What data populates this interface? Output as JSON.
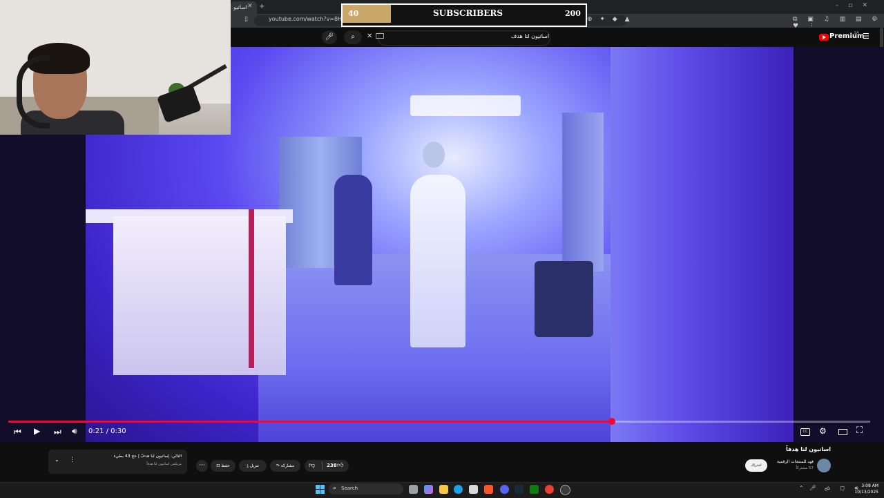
{
  "browser": {
    "tab_title": "اساتيو",
    "url": "youtube.com/watch?v=8HjQWAd…dYDrk&start_radio=1"
  },
  "youtube": {
    "search_query": "اساتيون لنا هدف",
    "logo_text": "Premium",
    "logo_region": "SA"
  },
  "overlay": {
    "subscriber_current": "40",
    "subscriber_label": "SUBSCRIBERS",
    "subscriber_target": "200",
    "subscriber_progress": 0.2
  },
  "player": {
    "time_display": "0:21 / 0:30",
    "progress_fraction": 0.7
  },
  "video": {
    "title": "اساتيون لنا هدفاً",
    "channel_name": "فهد للمنتجات الرقمية",
    "channel_subs": "57 مشتركاً",
    "subscribe_label": "اشتراك",
    "like_count": "238",
    "share_label": "مشاركة",
    "download_label": "تنزيل",
    "save_label": "حفظ",
    "more_label": "···"
  },
  "mini_card": {
    "title": "التالي: إساتيون لنا هدفٌ | حج 43 بطيء",
    "subtitle": "مزيكس اساتيون لنا هدفاً"
  },
  "taskbar": {
    "search_placeholder": "Search",
    "lang": "ع",
    "clock_time": "3:08 AM",
    "clock_date": "10/13/2025"
  },
  "colors": {
    "progress": "#ff0033",
    "goal_fill": "#c9a86a",
    "yt_red": "#ff0000"
  }
}
